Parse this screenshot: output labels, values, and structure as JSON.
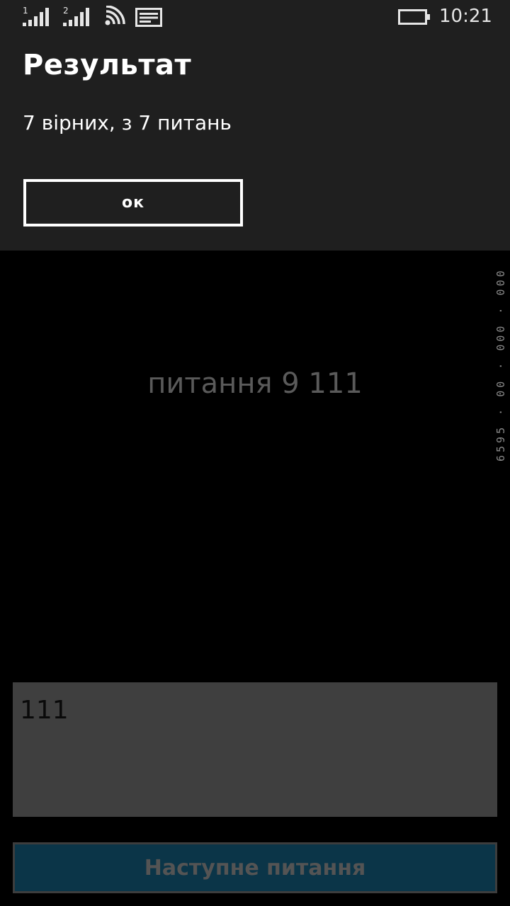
{
  "status_bar": {
    "sim1_label": "1",
    "sim2_label": "2",
    "time": "10:21",
    "icons": [
      "signal-sim1-icon",
      "signal-sim2-icon",
      "wifi-icon",
      "message-icon",
      "battery-icon"
    ]
  },
  "dialog": {
    "title": "Результат",
    "message": "7 вірних, з 7 питань",
    "ok_label": "ок"
  },
  "page": {
    "question": "питання 9 111",
    "answer_value": "111",
    "next_button_label": "Наступне питання",
    "frame_counter": "6595 · 00 · 000 · 000"
  },
  "colors": {
    "dialog_bg": "#1f1f1f",
    "page_bg": "#000000",
    "answer_bg": "#3f3f3f",
    "next_button_bg": "#0b3548"
  }
}
